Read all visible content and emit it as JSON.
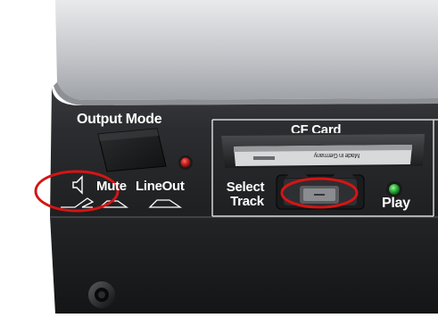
{
  "photo": {
    "subject": "audio-device-front-panel",
    "colors": {
      "background": "#ffffff",
      "chassis": "#2a2b2d",
      "top_lid": "#c9cbcf",
      "label_text": "#ffffff",
      "red_led": "#c41f1f",
      "green_led": "#2fae3c",
      "annotation": "#d41515"
    }
  },
  "panel": {
    "output_mode_label": "Output Mode",
    "mute_label": "Mute",
    "lineout_label": "LineOut",
    "cf_card_label": "CF Card",
    "card_print": "Made in Germany",
    "select_label": "Select",
    "track_label": "Track",
    "play_label": "Play"
  }
}
